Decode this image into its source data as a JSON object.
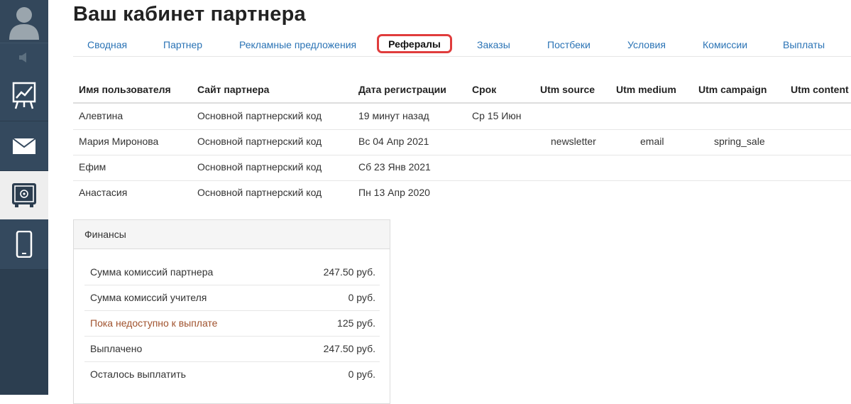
{
  "header": {
    "title": "Ваш кабинет партнера"
  },
  "tabs": [
    {
      "label": "Сводная"
    },
    {
      "label": "Партнер"
    },
    {
      "label": "Рекламные предложения"
    },
    {
      "label": "Рефералы",
      "active": true
    },
    {
      "label": "Заказы"
    },
    {
      "label": "Постбеки"
    },
    {
      "label": "Условия"
    },
    {
      "label": "Комиссии"
    },
    {
      "label": "Выплаты"
    }
  ],
  "referrals": {
    "columns": [
      "Имя пользователя",
      "Сайт партнера",
      "Дата регистрации",
      "Срок",
      "Utm source",
      "Utm medium",
      "Utm campaign",
      "Utm content"
    ],
    "rows": [
      {
        "name": "Алевтина",
        "site": "Основной партнерский код",
        "date": "19 минут назад",
        "term": "Ср 15 Июн",
        "utm_source": "",
        "utm_medium": "",
        "utm_campaign": "",
        "utm_content": ""
      },
      {
        "name": "Мария Миронова",
        "site": "Основной партнерский код",
        "date": "Вс 04 Апр 2021",
        "term": "",
        "utm_source": "newsletter",
        "utm_medium": "email",
        "utm_campaign": "spring_sale",
        "utm_content": ""
      },
      {
        "name": "Ефим",
        "site": "Основной партнерский код",
        "date": "Сб 23 Янв 2021",
        "term": "",
        "utm_source": "",
        "utm_medium": "",
        "utm_campaign": "",
        "utm_content": ""
      },
      {
        "name": "Анастасия",
        "site": "Основной партнерский код",
        "date": "Пн 13 Апр 2020",
        "term": "",
        "utm_source": "",
        "utm_medium": "",
        "utm_campaign": "",
        "utm_content": ""
      }
    ]
  },
  "finance": {
    "title": "Финансы",
    "rows": [
      {
        "label": "Сумма комиссий партнера",
        "value": "247.50 руб."
      },
      {
        "label": "Сумма комиссий учителя",
        "value": "0 руб."
      },
      {
        "label": "Пока недоступно к выплате",
        "value": "125 руб."
      },
      {
        "label": "Выплачено",
        "value": "247.50 руб."
      },
      {
        "label": "Осталось выплатить",
        "value": "0 руб."
      }
    ]
  },
  "sidebar": {
    "icons": [
      "avatar-icon",
      "speaker-icon",
      "chart-icon",
      "mail-icon",
      "safe-icon",
      "phone-icon"
    ]
  },
  "colors": {
    "sidebar": "#2c3e50",
    "link": "#2a73b5",
    "active_tab_border": "#e03c3c",
    "warning_text": "#a0522d"
  }
}
